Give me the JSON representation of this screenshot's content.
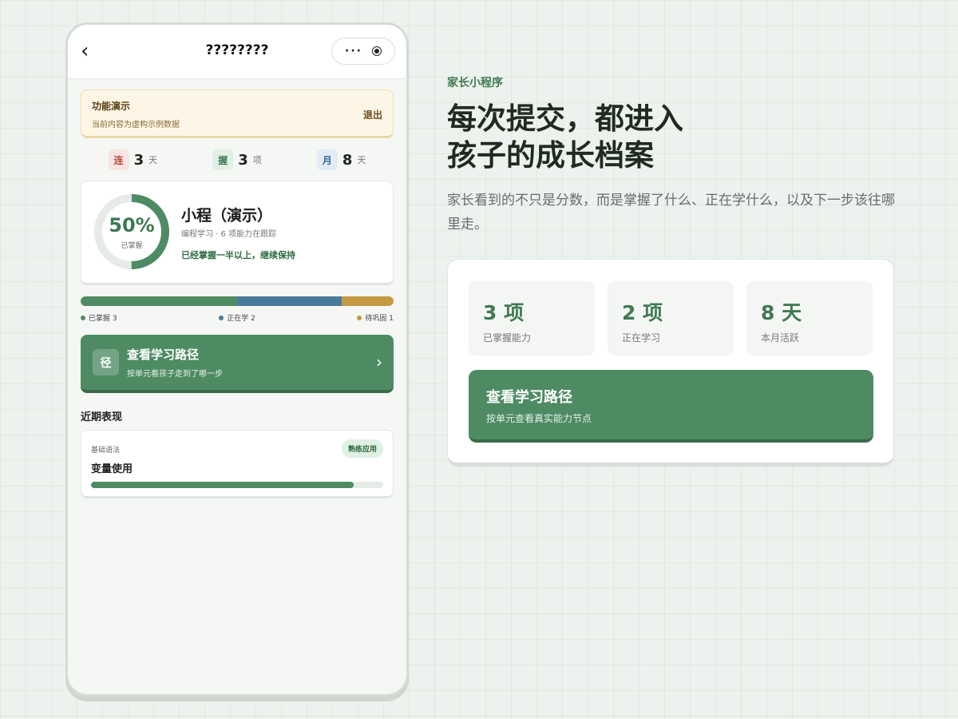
{
  "phone": {
    "nav": {
      "back_icon": "chevron-left-icon",
      "title": "????????",
      "more_dots": "···",
      "record_icon": "record-icon"
    },
    "demo_banner": {
      "title": "功能演示",
      "subtitle": "当前内容为虚构示例数据",
      "exit_label": "退出"
    },
    "stats": [
      {
        "badge": "连",
        "value": "3",
        "unit": "天",
        "color": "#b34a3e"
      },
      {
        "badge": "握",
        "value": "3",
        "unit": "项",
        "color": "#3f7a52"
      },
      {
        "badge": "月",
        "value": "8",
        "unit": "天",
        "color": "#3d6496"
      }
    ],
    "progress": {
      "percent_text": "50%",
      "percent": 50,
      "percent_label": "已掌握",
      "course_name": "小程（演示）",
      "course_meta": "编程学习 · 6 项能力在跟踪",
      "note": "已经掌握一半以上，继续保持"
    },
    "breakdown": {
      "segments": [
        {
          "label": "已掌握 3",
          "count": 3,
          "color": "#4e8b63"
        },
        {
          "label": "正在学 2",
          "count": 2,
          "color": "#4a7a9a"
        },
        {
          "label": "待巩固 1",
          "count": 1,
          "color": "#c49a45"
        }
      ]
    },
    "path_button": {
      "icon_text": "径",
      "title": "查看学习路径",
      "subtitle": "按单元看孩子走到了哪一步",
      "arrow": "›"
    },
    "recent": {
      "section_title": "近期表现",
      "item": {
        "category": "基础语法",
        "name": "变量使用",
        "tag": "熟练应用",
        "progress": 0.9
      }
    }
  },
  "side": {
    "eyebrow": "家长小程序",
    "headline_line1": "每次提交，都进入",
    "headline_line2": "孩子的成长档案",
    "description": "家长看到的不只是分数，而是掌握了什么、正在学什么，以及下一步该往哪里走。",
    "metrics": [
      {
        "value": "3 项",
        "label": "已掌握能力"
      },
      {
        "value": "2 项",
        "label": "正在学习"
      },
      {
        "value": "8 天",
        "label": "本月活跃"
      }
    ],
    "button": {
      "title": "查看学习路径",
      "subtitle": "按单元查看真实能力节点"
    }
  },
  "colors": {
    "accent": "#4e8b63",
    "accent_dark": "#3a6a4a",
    "background": "#edf2ee"
  }
}
